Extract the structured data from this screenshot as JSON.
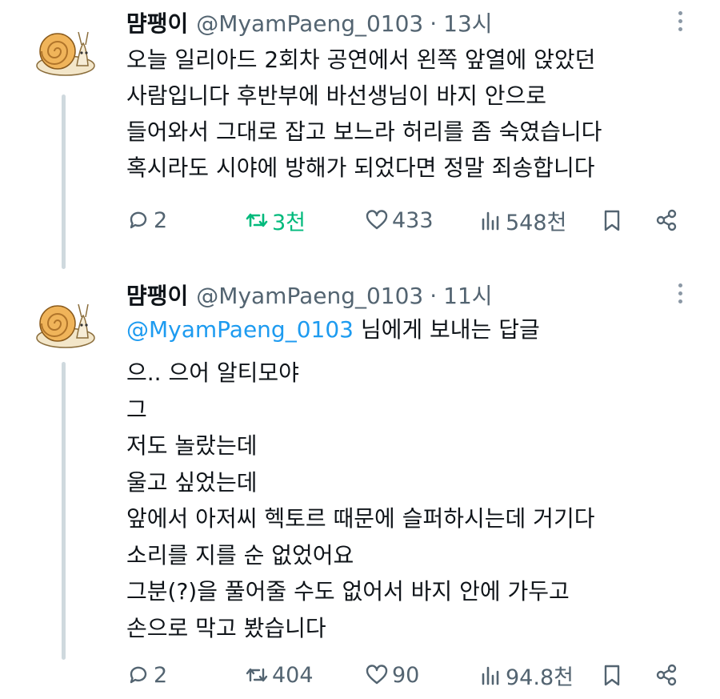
{
  "tweets": [
    {
      "name": "먐팽이",
      "handle": "@MyamPaeng_0103",
      "separator": "·",
      "time": "13시",
      "reply_to": null,
      "lines": [
        "오늘 일리아드 2회차 공연에서 왼쪽 앞열에 앉았던",
        "사람입니다 후반부에 바선생님이 바지 안으로",
        "들어와서 그대로 잡고 보느라 허리를 좀 숙였습니다",
        "혹시라도 시야에 방해가 되었다면 정말 죄송합니다"
      ],
      "replies": "2",
      "retweets": "3천",
      "likes": "433",
      "views": "548천",
      "retweet_active": true
    },
    {
      "name": "먐팽이",
      "handle": "@MyamPaeng_0103",
      "separator": "·",
      "time": "11시",
      "reply_to": {
        "mention": "@MyamPaeng_0103",
        "suffix": " 님에게 보내는 답글"
      },
      "lines": [
        "으.. 으어 알티모야",
        "그",
        "저도 놀랐는데",
        "울고 싶었는데",
        "앞에서 아저씨 헥토르 때문에 슬퍼하시는데 거기다",
        "소리를 지를 순 없었어요",
        "그분(?)을 풀어줄 수도 없어서 바지 안에 가두고",
        "손으로 막고 봤습니다"
      ],
      "replies": "2",
      "retweets": "404",
      "likes": "90",
      "views": "94.8천",
      "retweet_active": false
    }
  ],
  "colors": {
    "text": "#0f1419",
    "secondary": "#536471",
    "accent": "#1d9bf0",
    "retweet_active": "#00ba7c"
  },
  "icons": [
    "reply-icon",
    "retweet-icon",
    "like-icon",
    "views-icon",
    "bookmark-icon",
    "share-icon",
    "more-icon"
  ]
}
